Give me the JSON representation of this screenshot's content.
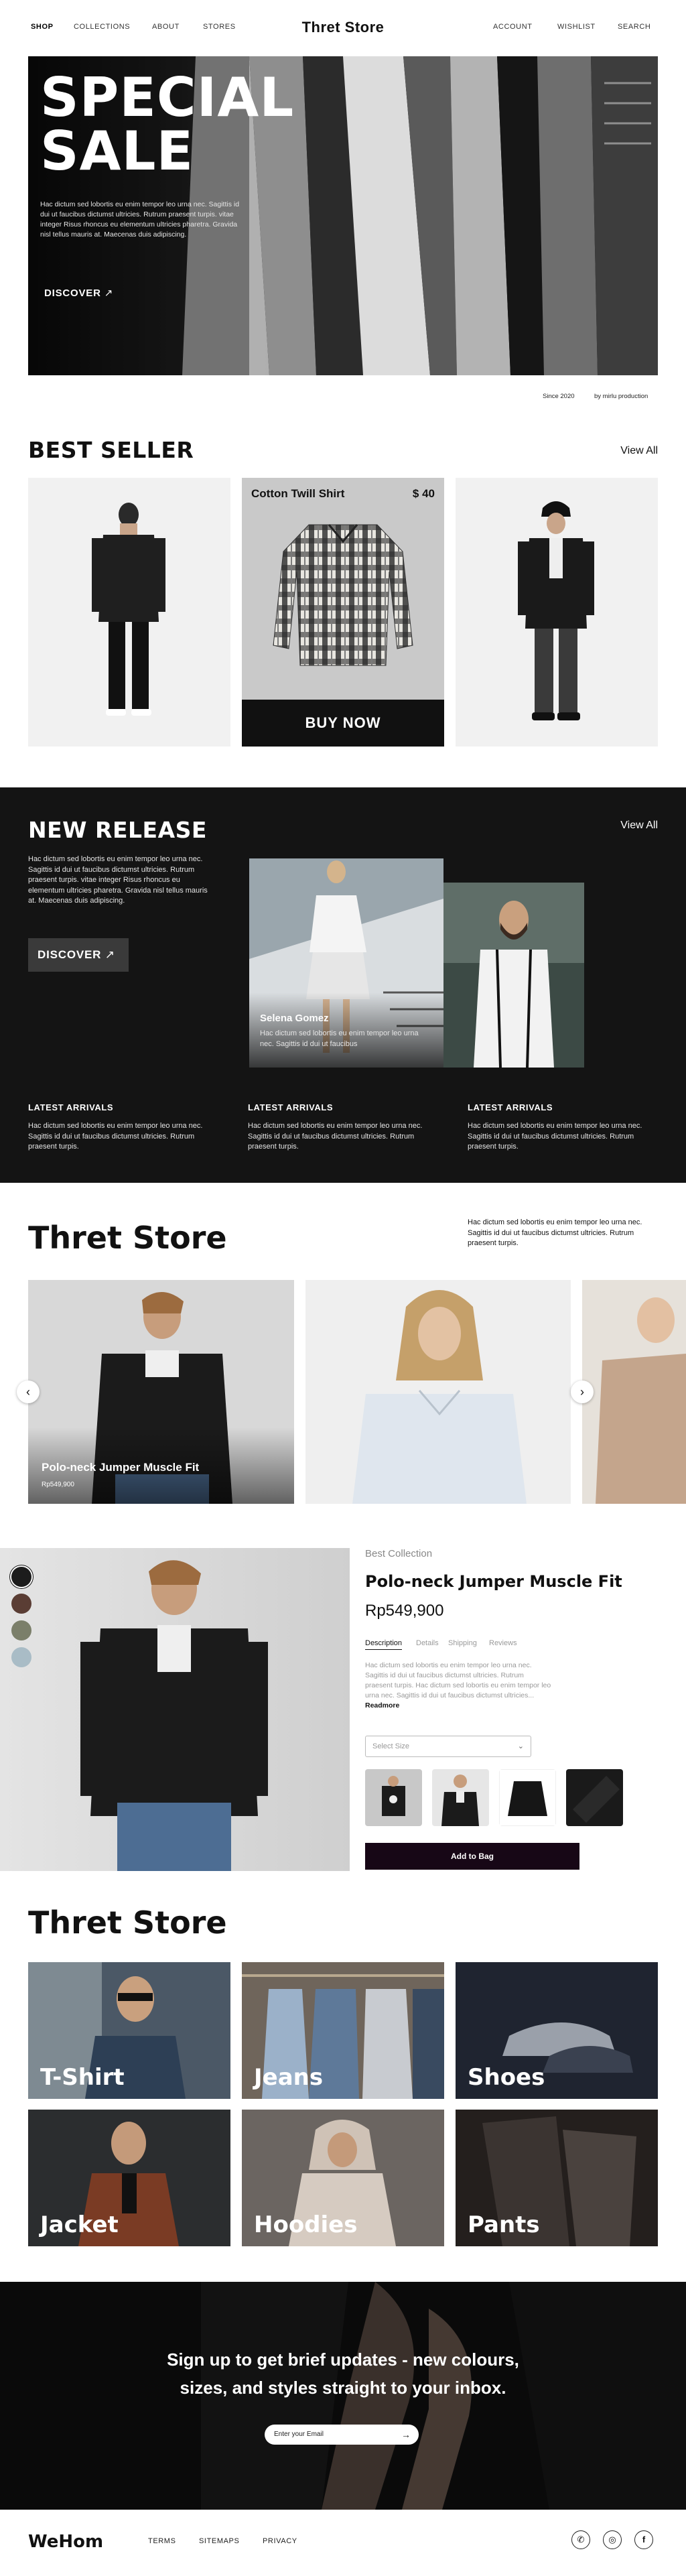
{
  "nav": {
    "left": [
      "SHOP",
      "COLLECTIONS",
      "ABOUT",
      "STORES"
    ],
    "brand": "Thret Store",
    "right": [
      "ACCOUNT",
      "WISHLIST",
      "SEARCH"
    ]
  },
  "hero": {
    "title_line1": "SPECIAL",
    "title_line2": "SALE",
    "text": "Hac dictum sed lobortis eu enim tempor leo urna nec. Sagittis id dui ut faucibus dictumst ultricies. Rutrum praesent turpis. vitae integer Risus rhoncus eu elementum ultricies pharetra. Gravida nisl tellus mauris at. Maecenas duis adipiscing.",
    "cta": "DISCOVER",
    "since": "Since 2020",
    "credit": "by mirlu production"
  },
  "best_seller": {
    "title": "BEST SELLER",
    "view_all": "View All",
    "featured_name": "Cotton Twill Shirt",
    "featured_price": "$ 40",
    "buy": "BUY NOW"
  },
  "new_release": {
    "title": "NEW RELEASE",
    "view_all": "View All",
    "text": "Hac dictum sed lobortis eu enim tempor leo urna nec. Sagittis id dui ut faucibus dictumst ultricies. Rutrum praesent turpis. vitae integer Risus rhoncus eu elementum ultricies pharetra. Gravida nisl tellus mauris at. Maecenas duis adipiscing.",
    "cta": "DISCOVER",
    "model_name": "Selena Gomez",
    "model_text": "Hac dictum sed lobortis eu enim tempor leo urna nec. Sagittis id dui ut faucibus",
    "arrivals": [
      {
        "title": "LATEST ARRIVALS",
        "text": "Hac dictum sed lobortis eu enim tempor leo urna nec. Sagittis id dui ut faucibus dictumst ultricies. Rutrum praesent turpis."
      },
      {
        "title": "LATEST ARRIVALS",
        "text": "Hac dictum sed lobortis eu enim tempor leo urna nec. Sagittis id dui ut faucibus dictumst ultricies. Rutrum praesent turpis."
      },
      {
        "title": "LATEST ARRIVALS",
        "text": "Hac dictum sed lobortis eu enim tempor leo urna nec. Sagittis id dui ut faucibus dictumst ultricies. Rutrum praesent turpis."
      }
    ]
  },
  "showcase": {
    "title": "Thret Store",
    "text": "Hac dictum sed lobortis eu enim tempor leo urna nec. Sagittis id dui ut faucibus dictumst ultricies. Rutrum praesent turpis.",
    "card_name": "Polo-neck Jumper Muscle Fit",
    "card_price": "Rp549,900"
  },
  "product": {
    "collection": "Best Collection",
    "name": "Polo-neck Jumper Muscle Fit",
    "price": "Rp549,900",
    "tabs": [
      "Description",
      "Details",
      "Shipping",
      "Reviews"
    ],
    "description": "Hac dictum sed lobortis eu enim tempor leo urna nec. Sagittis id dui ut faucibus dictumst ultricies. Rutrum praesent turpis. Hac dictum sed lobortis eu enim tempor leo urna nec. Sagittis id dui ut faucibus dictumst ultricies...",
    "read_more": "Readmore",
    "size_placeholder": "Select Size",
    "add_to_bag": "Add to Bag",
    "swatch_colors": [
      "#1c1c1c",
      "#5a3d34",
      "#7b7f6a",
      "#a9bcc6"
    ]
  },
  "categories": {
    "title": "Thret Store",
    "items": [
      "T-Shirt",
      "Jeans",
      "Shoes",
      "Jacket",
      "Hoodies",
      "Pants"
    ]
  },
  "newsletter": {
    "line1": "Sign up to get brief updates - new colours,",
    "line2": "sizes, and styles straight to your inbox.",
    "placeholder": "Enter your Email"
  },
  "footer": {
    "brand": "WeHom",
    "links": [
      "TERMS",
      "SITEMAPS",
      "PRIVACY"
    ],
    "social_icons": [
      "whatsapp-icon",
      "instagram-icon",
      "facebook-icon"
    ]
  }
}
